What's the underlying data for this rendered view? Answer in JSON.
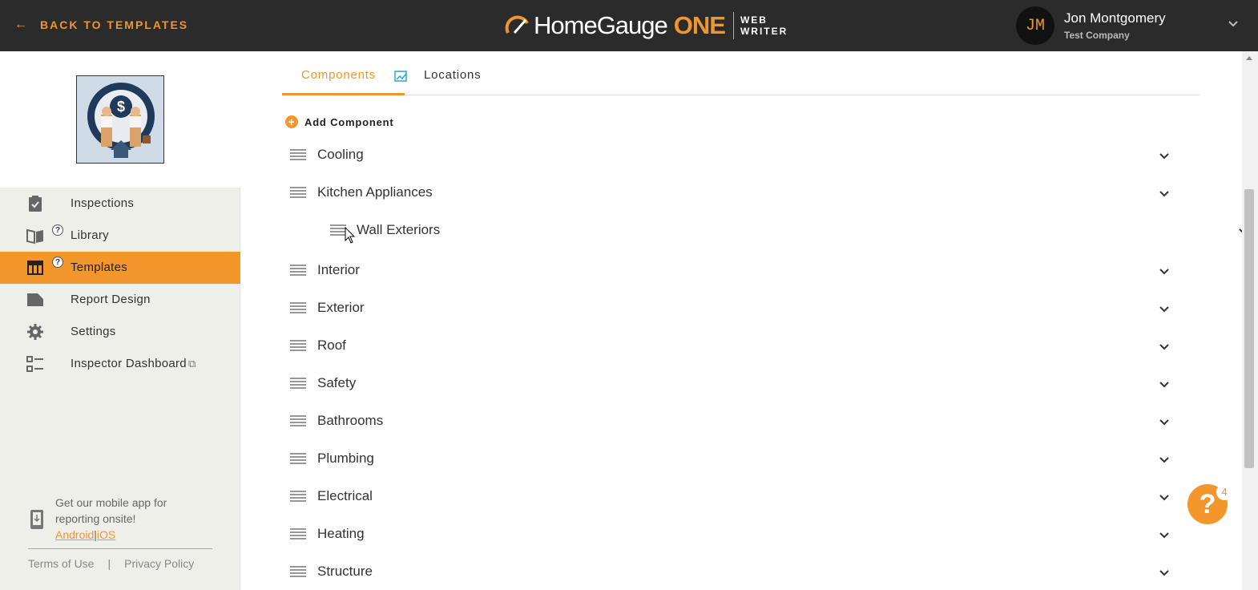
{
  "header": {
    "back_label": "BACK TO TEMPLATES",
    "brand_name": "HomeGauge",
    "brand_one": "ONE",
    "web_label": "WEB",
    "writer_label": "WRITER",
    "user_initials": "JM",
    "user_name": "Jon Montgomery",
    "user_company": "Test Company"
  },
  "colors": {
    "accent": "#f3962c",
    "topbar": "#2b2b2b",
    "sidebar_bg": "#efefea"
  },
  "sidebar": {
    "items": [
      {
        "label": "Inspections",
        "icon": "clipboard-check-icon",
        "active": false
      },
      {
        "label": "Library",
        "icon": "book-icon",
        "active": false
      },
      {
        "label": "Templates",
        "icon": "table-icon",
        "active": true
      },
      {
        "label": "Report Design",
        "icon": "folder-icon",
        "active": false
      },
      {
        "label": "Settings",
        "icon": "gear-icon",
        "active": false
      },
      {
        "label": "Inspector Dashboard",
        "icon": "list-icon",
        "active": false
      }
    ],
    "help_mark": "?",
    "external_mark": "⧉",
    "promo_line1": "Get our mobile app for",
    "promo_line2": "reporting onsite!",
    "android_label": "Android",
    "promo_sep": "|",
    "ios_label": "iOS",
    "terms_label": "Terms of Use",
    "footer_sep": "|",
    "privacy_label": "Privacy Policy"
  },
  "main": {
    "tabs": [
      {
        "label": "Components",
        "active": true
      },
      {
        "label": "Locations",
        "active": false
      }
    ],
    "add_component_label": "Add Component",
    "components": [
      {
        "label": "Cooling"
      },
      {
        "label": "Kitchen Appliances"
      },
      {
        "label": "Wall Exteriors",
        "dragging": true
      },
      {
        "label": "Interior"
      },
      {
        "label": "Exterior"
      },
      {
        "label": "Roof"
      },
      {
        "label": "Safety"
      },
      {
        "label": "Bathrooms"
      },
      {
        "label": "Plumbing"
      },
      {
        "label": "Electrical"
      },
      {
        "label": "Heating"
      },
      {
        "label": "Structure"
      }
    ]
  },
  "help": {
    "label": "?",
    "badge_count": "4"
  }
}
